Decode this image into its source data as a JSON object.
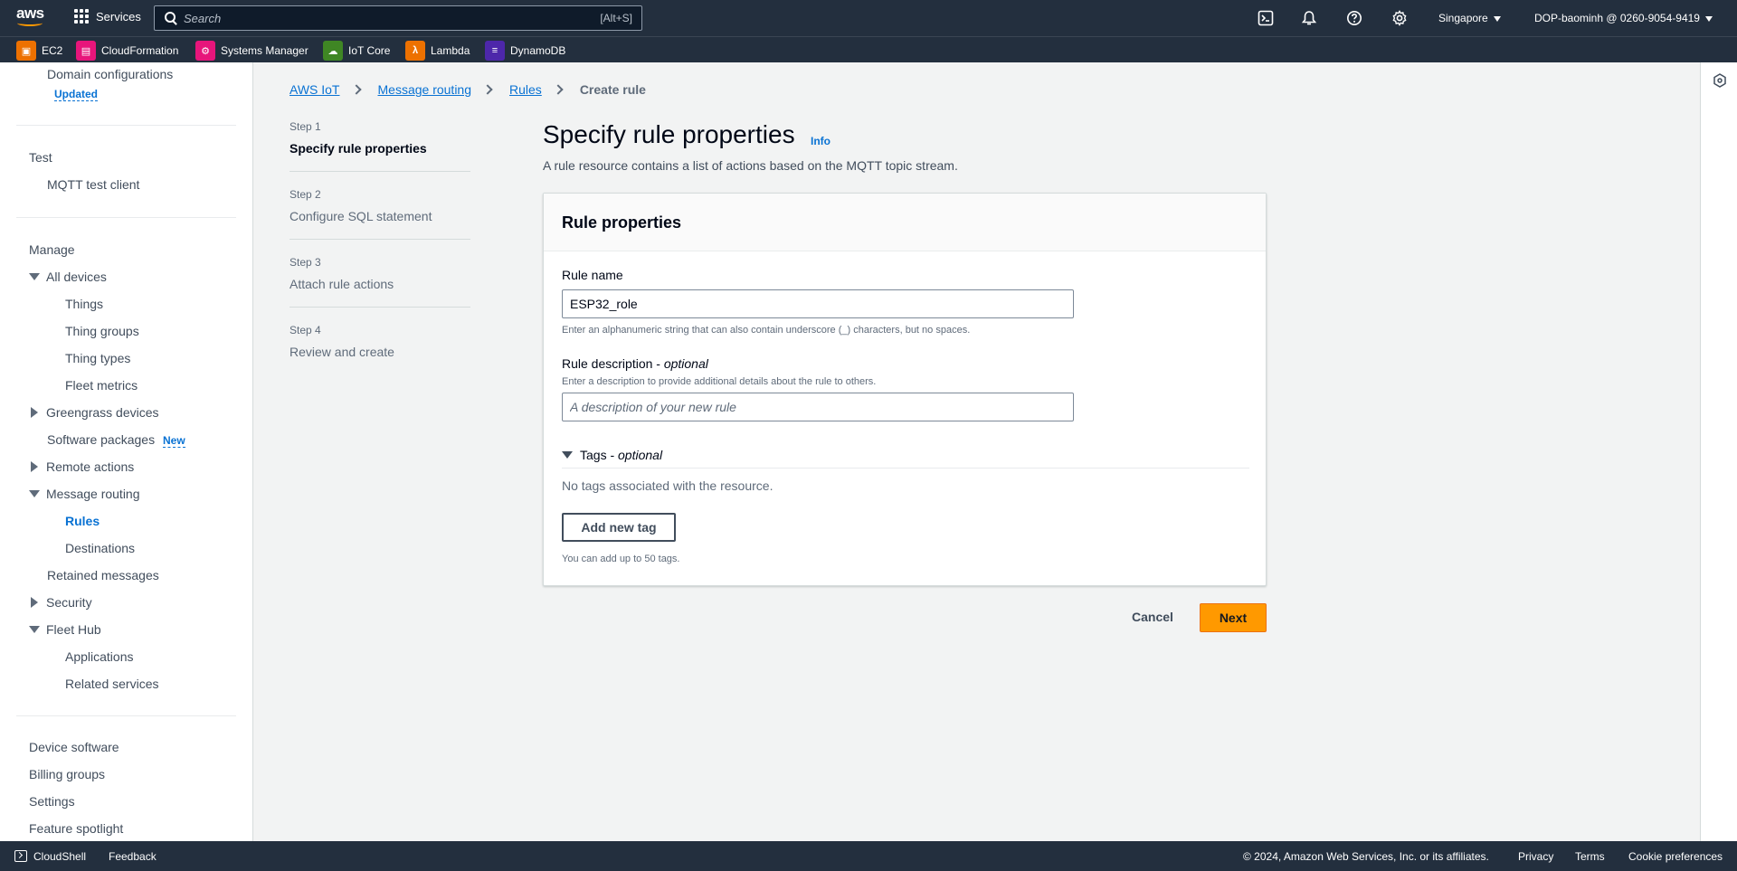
{
  "topnav": {
    "logo_text": "aws",
    "services_label": "Services",
    "search_placeholder": "Search",
    "search_shortcut": "[Alt+S]",
    "region": "Singapore",
    "account": "DOP-baominh @ 0260-9054-9419"
  },
  "favorites": [
    {
      "label": "EC2",
      "icon": "ec2-icon",
      "color": "#ed7100"
    },
    {
      "label": "CloudFormation",
      "icon": "cloudformation-icon",
      "color": "#e7157b"
    },
    {
      "label": "Systems Manager",
      "icon": "systems-manager-icon",
      "color": "#e7157b"
    },
    {
      "label": "IoT Core",
      "icon": "iot-core-icon",
      "color": "#3f8624"
    },
    {
      "label": "Lambda",
      "icon": "lambda-icon",
      "color": "#ed7100"
    },
    {
      "label": "DynamoDB",
      "icon": "dynamodb-icon",
      "color": "#4d27aa"
    }
  ],
  "sidebar": {
    "domain_configurations": "Domain configurations",
    "updated_badge": "Updated",
    "test_header": "Test",
    "mqtt_test_client": "MQTT test client",
    "manage_header": "Manage",
    "all_devices": "All devices",
    "things": "Things",
    "thing_groups": "Thing groups",
    "thing_types": "Thing types",
    "fleet_metrics": "Fleet metrics",
    "greengrass_devices": "Greengrass devices",
    "software_packages": "Software packages",
    "new_badge": "New",
    "remote_actions": "Remote actions",
    "message_routing": "Message routing",
    "rules": "Rules",
    "destinations": "Destinations",
    "retained_messages": "Retained messages",
    "security": "Security",
    "fleet_hub": "Fleet Hub",
    "applications": "Applications",
    "related_services": "Related services",
    "device_software": "Device software",
    "billing_groups": "Billing groups",
    "settings": "Settings",
    "feature_spotlight": "Feature spotlight"
  },
  "breadcrumb": {
    "items": [
      "AWS IoT",
      "Message routing",
      "Rules"
    ],
    "current": "Create rule"
  },
  "steps": [
    {
      "label": "Step 1",
      "title": "Specify rule properties"
    },
    {
      "label": "Step 2",
      "title": "Configure SQL statement"
    },
    {
      "label": "Step 3",
      "title": "Attach rule actions"
    },
    {
      "label": "Step 4",
      "title": "Review and create"
    }
  ],
  "main": {
    "title": "Specify rule properties",
    "info_link": "Info",
    "description": "A rule resource contains a list of actions based on the MQTT topic stream."
  },
  "card": {
    "header": "Rule properties",
    "rule_name_label": "Rule name",
    "rule_name_value": "ESP32_role",
    "rule_name_hint": "Enter an alphanumeric string that can also contain underscore (_) characters, but no spaces.",
    "rule_desc_label": "Rule description - ",
    "rule_desc_optional": "optional",
    "rule_desc_hint": "Enter a description to provide additional details about the rule to others.",
    "rule_desc_placeholder": "A description of your new rule",
    "tags_label": "Tags - ",
    "tags_optional": "optional",
    "no_tags": "No tags associated with the resource.",
    "add_tag_button": "Add new tag",
    "tags_limit": "You can add up to 50 tags."
  },
  "actions": {
    "cancel": "Cancel",
    "next": "Next"
  },
  "footer": {
    "cloudshell": "CloudShell",
    "feedback": "Feedback",
    "copyright": "© 2024, Amazon Web Services, Inc. or its affiliates.",
    "privacy": "Privacy",
    "terms": "Terms",
    "cookie_preferences": "Cookie preferences"
  }
}
